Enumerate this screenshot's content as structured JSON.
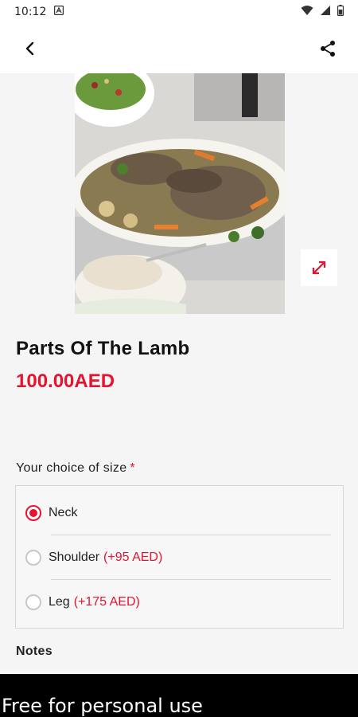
{
  "status_bar": {
    "time": "10:12",
    "icons": [
      "notification-a-icon",
      "wifi-icon",
      "signal-icon",
      "battery-icon"
    ]
  },
  "top_bar": {
    "back_icon": "back-arrow-icon",
    "share_icon": "share-icon"
  },
  "product": {
    "image_alt_icon": "food-photo",
    "expand_icon": "expand-icon",
    "title": "Parts Of The Lamb",
    "price": "100.00AED"
  },
  "size_section": {
    "label": "Your choice of size",
    "required_mark": "*",
    "options": [
      {
        "label": "Neck",
        "extra": "",
        "selected": true
      },
      {
        "label": "Shoulder",
        "extra": "(+95 AED)",
        "selected": false
      },
      {
        "label": "Leg",
        "extra": "(+175 AED)",
        "selected": false
      }
    ]
  },
  "notes": {
    "label": "Notes"
  },
  "watermark": "Free for personal use",
  "colors": {
    "accent": "#e5132f",
    "background": "#f5f5f5"
  }
}
